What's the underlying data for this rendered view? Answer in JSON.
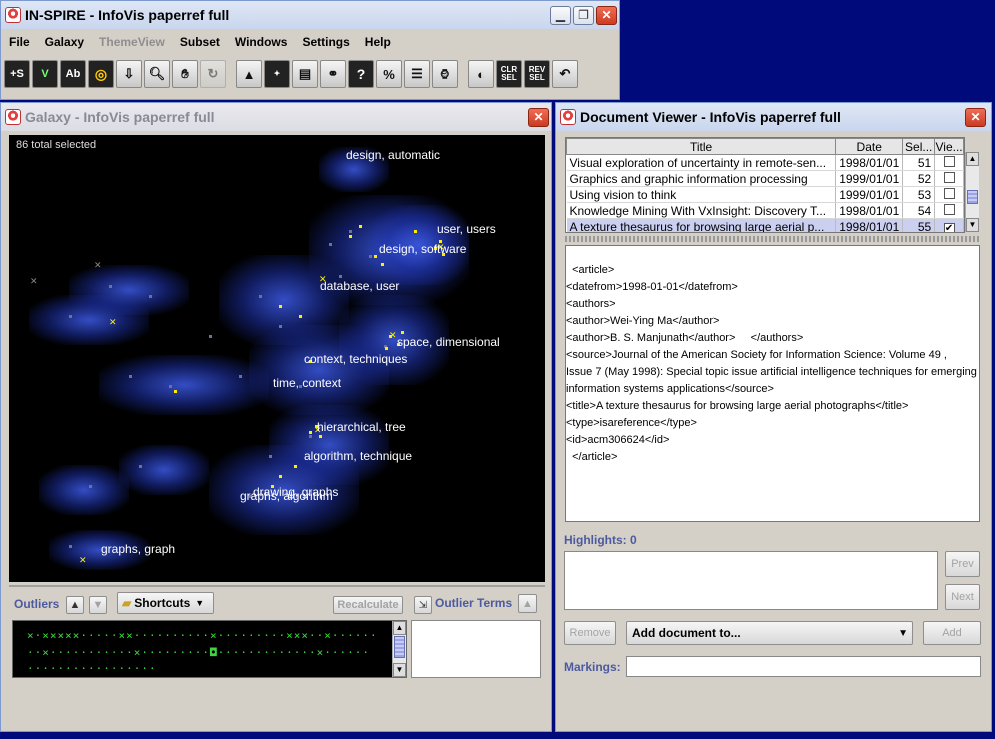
{
  "main_window": {
    "title": "IN-SPIRE - InfoVis paperref full",
    "menu": [
      "File",
      "Galaxy",
      "ThemeView",
      "Subset",
      "Windows",
      "Settings",
      "Help"
    ],
    "toolbar_labels": {
      "select_s": "+S",
      "select_v": "V",
      "select_ab": "Ab",
      "percent": "%",
      "clr_sel": "CLR SEL",
      "rev_sel": "REV SEL"
    }
  },
  "galaxy_window": {
    "title": "Galaxy - InfoVis paperref full",
    "total_selected": "86 total selected",
    "theme_labels": [
      "design, automatic",
      "user, users",
      "design, software",
      "database, user",
      "space, dimensional",
      "context, techniques",
      "time, context",
      "hierarchical, tree",
      "algorithm, technique",
      "drawing, graphs",
      "graphs, algorithm",
      "graphs, graph"
    ],
    "outliers_label": "Outliers",
    "shortcuts_label": "Shortcuts",
    "recalculate_label": "Recalculate",
    "outlier_terms_label": "Outlier Terms",
    "outlier_rows": [
      "×·×××××·····××··········×·········×××··×······",
      "··×···········×·········◘·············×······",
      "·················"
    ]
  },
  "doc_viewer": {
    "title": "Document Viewer - InfoVis paperref full",
    "columns": [
      "Title",
      "Date",
      "Sel...",
      "Vie..."
    ],
    "rows": [
      {
        "title": "Visual exploration of uncertainty in remote-sen...",
        "date": "1998/01/01",
        "sel": "51",
        "view": ""
      },
      {
        "title": "Graphics and graphic information processing",
        "date": "1999/01/01",
        "sel": "52",
        "view": ""
      },
      {
        "title": "Using vision to think",
        "date": "1999/01/01",
        "sel": "53",
        "view": ""
      },
      {
        "title": "Knowledge Mining With VxInsight: Discovery T...",
        "date": "1998/01/01",
        "sel": "54",
        "view": ""
      },
      {
        "title": "A texture thesaurus for browsing large aerial p...",
        "date": "1998/01/01",
        "sel": "55",
        "view": "✔"
      }
    ],
    "xml_lines": [
      "  <article>",
      "<datefrom>1998-01-01</datefrom>",
      "<authors>",
      "<author>Wei-Ying Ma</author>",
      "<author>B. S. Manjunath</author>     </authors>",
      "<source>Journal of the American Society for Information Science: Volume 49 ,          Issue 7 (May 1998): Special topic issue artificial intelligence techniques for emerging          information systems applications</source>",
      "<title>A texture thesaurus for browsing large aerial photographs</title>",
      "<type>isareference</type>",
      "<id>acm306624</id>",
      "  </article>"
    ],
    "highlights_label": "Highlights: 0",
    "prev_label": "Prev",
    "next_label": "Next",
    "remove_label": "Remove",
    "add_document_label": "Add document to...",
    "add_label": "Add",
    "markings_label": "Markings:"
  }
}
